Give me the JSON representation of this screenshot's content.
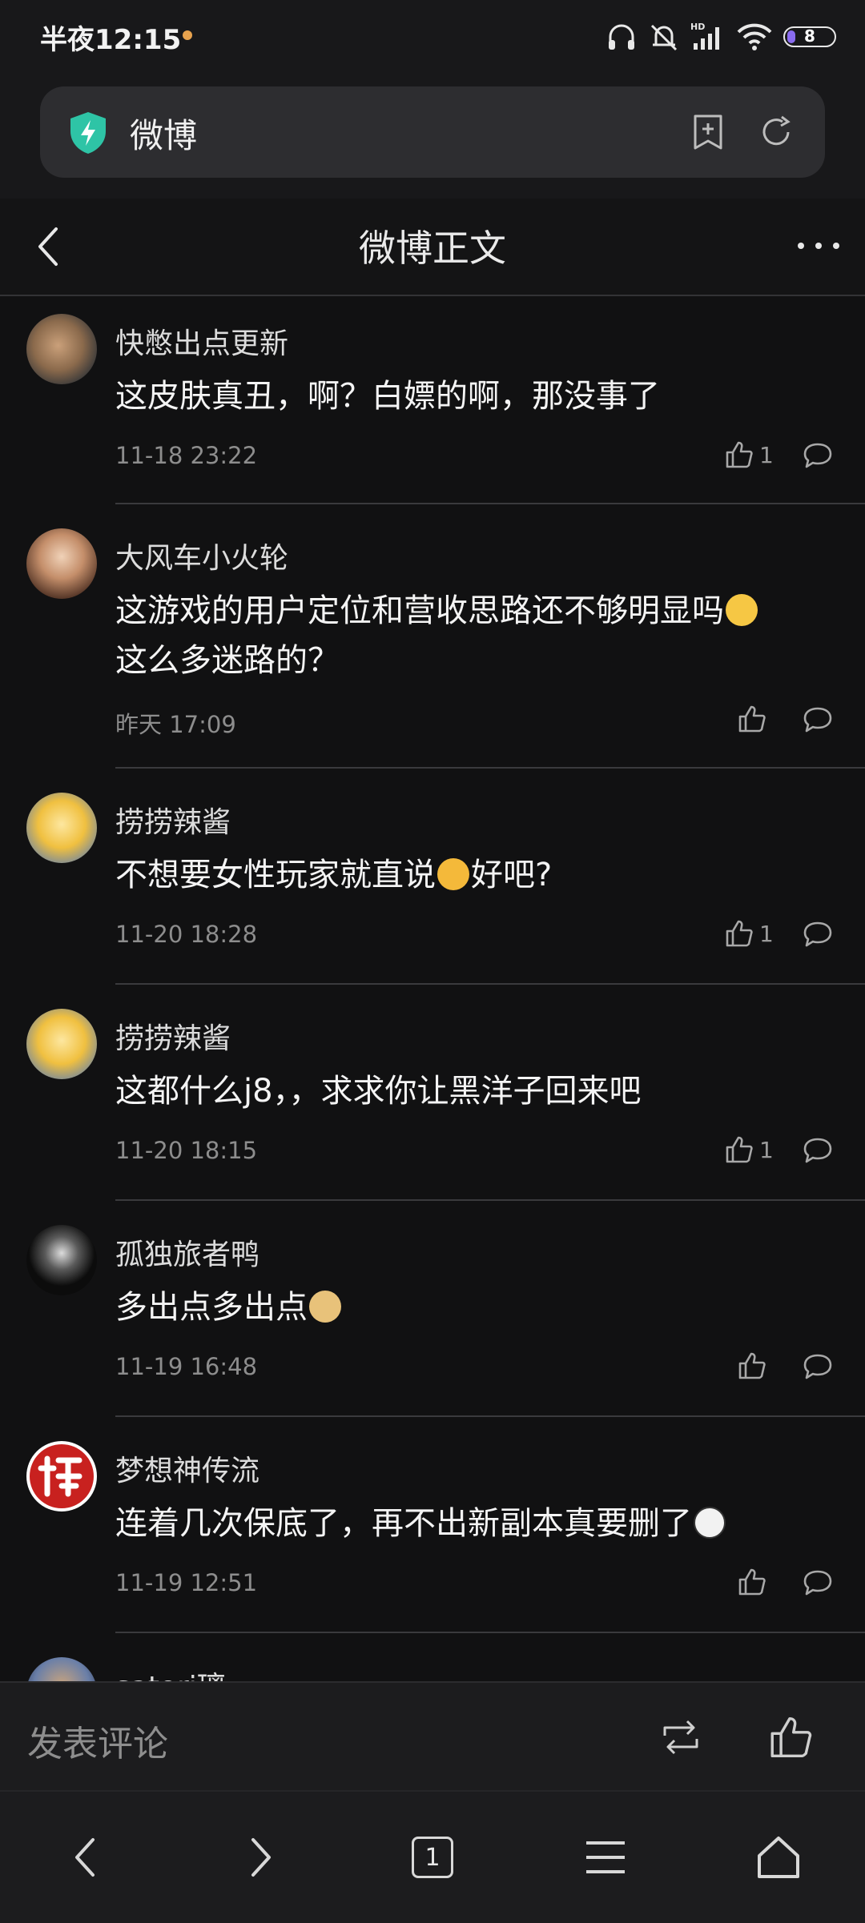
{
  "status_bar": {
    "time": "半夜12:15",
    "battery": "8",
    "icons": [
      "headphones-icon",
      "bell-muted-icon",
      "hd-signal-icon",
      "wifi-icon",
      "battery-icon"
    ]
  },
  "address_bar": {
    "title": "微博",
    "icons": [
      "shield-bolt-icon",
      "bookmark-add-icon",
      "reload-icon"
    ]
  },
  "page_header": {
    "title": "微博正文",
    "icons": [
      "back-arrow-icon",
      "more-dots-icon"
    ]
  },
  "comments": [
    {
      "user": "快憋出点更新",
      "text": "这皮肤真丑，啊？白嫖的啊，那没事了",
      "time": "11-18 23:22",
      "likes": "1"
    },
    {
      "user": "大风车小火轮",
      "text": "这游戏的用户定位和营收思路还不够明显吗",
      "text2": "这么多迷路的？",
      "time": "昨天 17:09",
      "likes": ""
    },
    {
      "user": "捞捞辣酱",
      "text": "不想要女性玩家就直说",
      "text2": "好吧?",
      "time": "11-20 18:28",
      "likes": "1"
    },
    {
      "user": "捞捞辣酱",
      "text": "这都什么j8，，求求你让黑洋子回来吧",
      "time": "11-20 18:15",
      "likes": "1"
    },
    {
      "user": "孤独旅者鸭",
      "text": "多出点多出点",
      "time": "11-19 16:48",
      "likes": ""
    },
    {
      "user": "梦想神传流",
      "text": "连着几次保底了，再不出新副本真要删了",
      "time": "11-19 12:51",
      "likes": ""
    },
    {
      "user": "satori璃"
    }
  ],
  "comment_bar": {
    "placeholder": "发表评论",
    "icons": [
      "repost-icon",
      "like-icon"
    ]
  },
  "nav_bar": {
    "tab_count": "1",
    "icons": [
      "nav-back-icon",
      "nav-forward-icon",
      "tabs-icon",
      "menu-icon",
      "home-icon"
    ]
  },
  "colors": {
    "background": "#111112",
    "accent_shield": "#2ec4a6",
    "battery_level": "#8a6cf0"
  }
}
